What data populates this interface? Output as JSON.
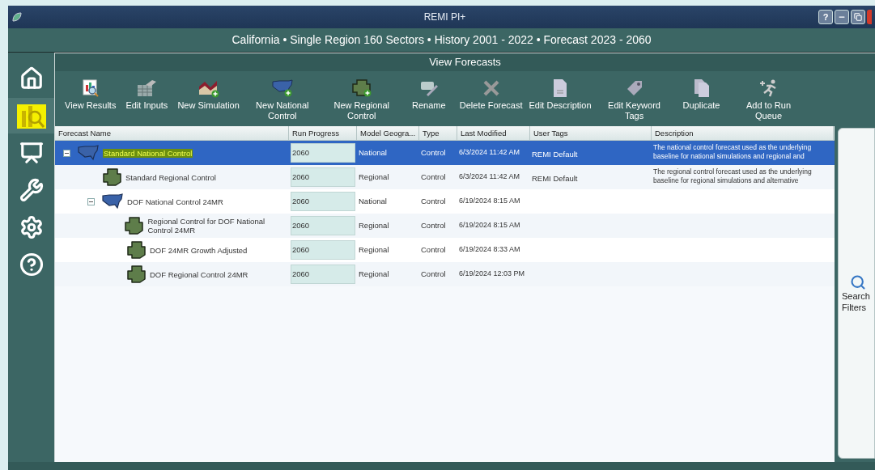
{
  "window": {
    "title": "REMI PI+"
  },
  "subtitle": "California • Single Region 160 Sectors • History 2001 - 2022 • Forecast 2023 - 2060",
  "sidebar": {
    "items": [
      {
        "selected": false
      },
      {
        "selected": true
      },
      {
        "selected": false
      },
      {
        "selected": false
      },
      {
        "selected": false
      },
      {
        "selected": false
      }
    ]
  },
  "panel": {
    "title": "View Forecasts"
  },
  "toolbar": [
    "View Results",
    "Edit Inputs",
    "New Simulation",
    "New National Control",
    "New Regional Control",
    "Rename",
    "Delete Forecast",
    "Edit Description",
    "Edit Keyword Tags",
    "Duplicate",
    "Add to Run Queue"
  ],
  "table": {
    "columns": [
      "Forecast Name",
      "Run Progress",
      "Model Geogra...",
      "Type",
      "Last Modified",
      "User Tags",
      "Description"
    ],
    "rows": [
      {
        "kind": "national",
        "name": "Standard National Control",
        "progress": "2060",
        "geography": "National",
        "type": "Control",
        "modified": "6/3/2024 11:42 AM",
        "tags": "REMI Default",
        "description": "The national control forecast used as the underlying baseline for national simulations and regional and",
        "selected": true,
        "expanded": true,
        "children": [
          {
            "kind": "regional",
            "name": "Standard Regional Control",
            "progress": "2060",
            "geography": "Regional",
            "type": "Control",
            "modified": "6/3/2024 11:42 AM",
            "tags": "REMI Default",
            "description": "The regional control forecast used as the underlying baseline for regional simulations and alternative",
            "selected": false
          },
          {
            "kind": "national",
            "name": "DOF National Control 24MR",
            "progress": "2060",
            "geography": "National",
            "type": "Control",
            "modified": "6/19/2024 8:15 AM",
            "selected": false,
            "expanded": true,
            "children": [
              {
                "kind": "regional",
                "name": "Regional Control for DOF National Control 24MR",
                "progress": "2060",
                "geography": "Regional",
                "type": "Control",
                "modified": "6/19/2024 8:15 AM",
                "selected": false
              },
              {
                "kind": "regional",
                "name": "DOF 24MR Growth Adjusted",
                "progress": "2060",
                "geography": "Regional",
                "type": "Control",
                "modified": "6/19/2024 8:33 AM",
                "selected": false
              },
              {
                "kind": "regional",
                "name": "DOF Regional Control 24MR",
                "progress": "2060",
                "geography": "Regional",
                "type": "Control",
                "modified": "6/19/2024 12:03 PM",
                "selected": false
              }
            ]
          }
        ]
      }
    ]
  },
  "search_panel": {
    "label": "Search Filters"
  },
  "title_buttons": [
    "?"
  ]
}
